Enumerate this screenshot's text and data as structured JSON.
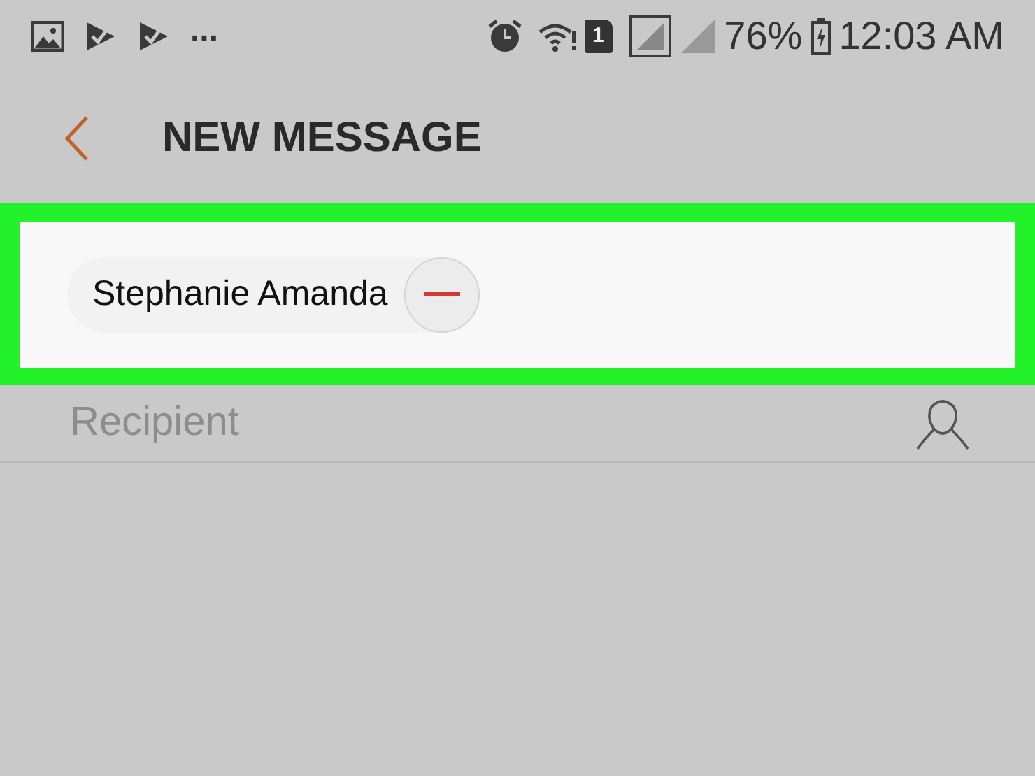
{
  "status_bar": {
    "overflow": "...",
    "sim_slot": "1",
    "battery": "76%",
    "time": "12:03 AM"
  },
  "header": {
    "title": "NEW MESSAGE"
  },
  "recipients": [
    {
      "name": "Stephanie Amanda"
    }
  ],
  "recipient_field": {
    "placeholder": "Recipient"
  }
}
